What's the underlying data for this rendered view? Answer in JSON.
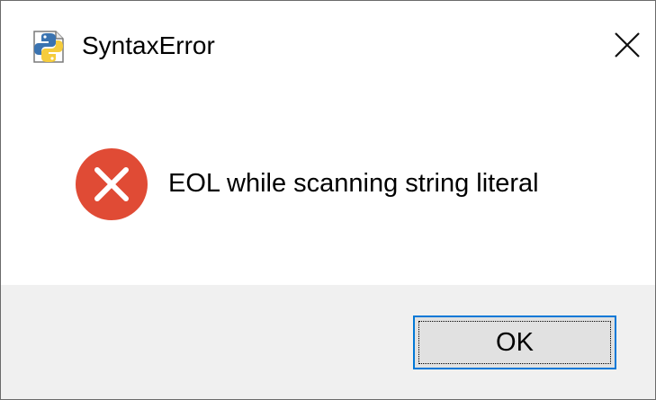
{
  "window": {
    "title": "SyntaxError",
    "app_icon": "python-icon",
    "close_icon": "close-icon"
  },
  "content": {
    "icon": "error-icon",
    "message": "EOL while scanning string literal"
  },
  "buttons": {
    "ok_label": "OK"
  },
  "colors": {
    "error_red": "#e04b35",
    "accent_blue": "#0078d7",
    "footer_bg": "#f0f0f0",
    "python_blue": "#3a73b0",
    "python_yellow": "#f5cc3c"
  }
}
